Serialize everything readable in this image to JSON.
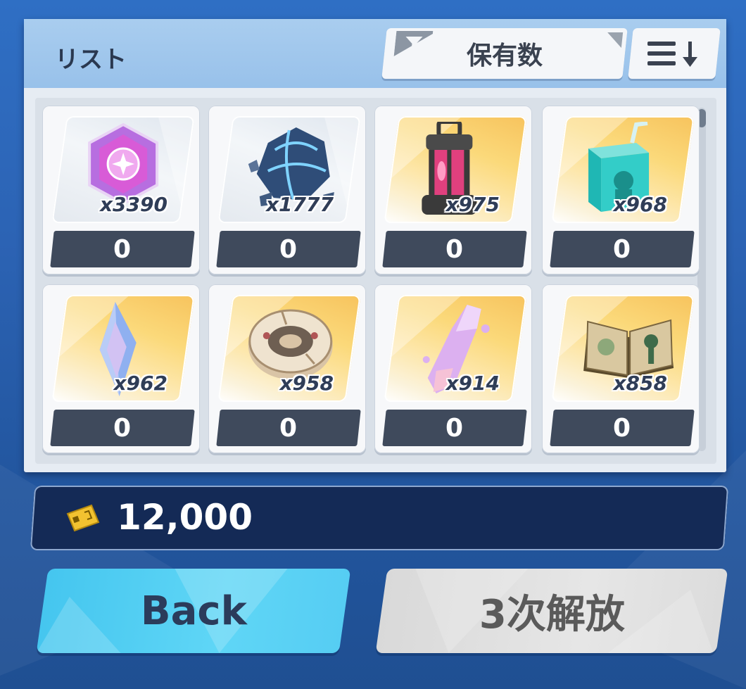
{
  "panel": {
    "title": "リスト",
    "filter_label": "保有数",
    "filter_icon": "funnel-icon",
    "sort_icon": "sort-descending-icon"
  },
  "items": [
    {
      "name": "pink-gem",
      "qty": "x3390",
      "count": "0",
      "bg": "silver"
    },
    {
      "name": "blue-crystal-ore",
      "qty": "x1777",
      "count": "0",
      "bg": "silver"
    },
    {
      "name": "pink-lantern",
      "qty": "x975",
      "count": "0",
      "bg": "gold"
    },
    {
      "name": "juice-box",
      "qty": "x968",
      "count": "0",
      "bg": "gold"
    },
    {
      "name": "blue-crystal-shard",
      "qty": "x962",
      "count": "0",
      "bg": "gold"
    },
    {
      "name": "stone-disc",
      "qty": "x958",
      "count": "0",
      "bg": "gold"
    },
    {
      "name": "pink-crystal-fragment",
      "qty": "x914",
      "count": "0",
      "bg": "gold"
    },
    {
      "name": "old-book",
      "qty": "x858",
      "count": "0",
      "bg": "gold"
    }
  ],
  "currency": {
    "icon": "ticket-icon",
    "amount": "12,000"
  },
  "buttons": {
    "back": "Back",
    "release": "3次解放"
  },
  "colors": {
    "background": "#2c63b4",
    "panel_header": "#a3c8ee",
    "count_bar": "#3f4a5c",
    "currency_bar": "#142a56",
    "back_button": "#55cdf3",
    "release_button": "#dcdcdc"
  }
}
